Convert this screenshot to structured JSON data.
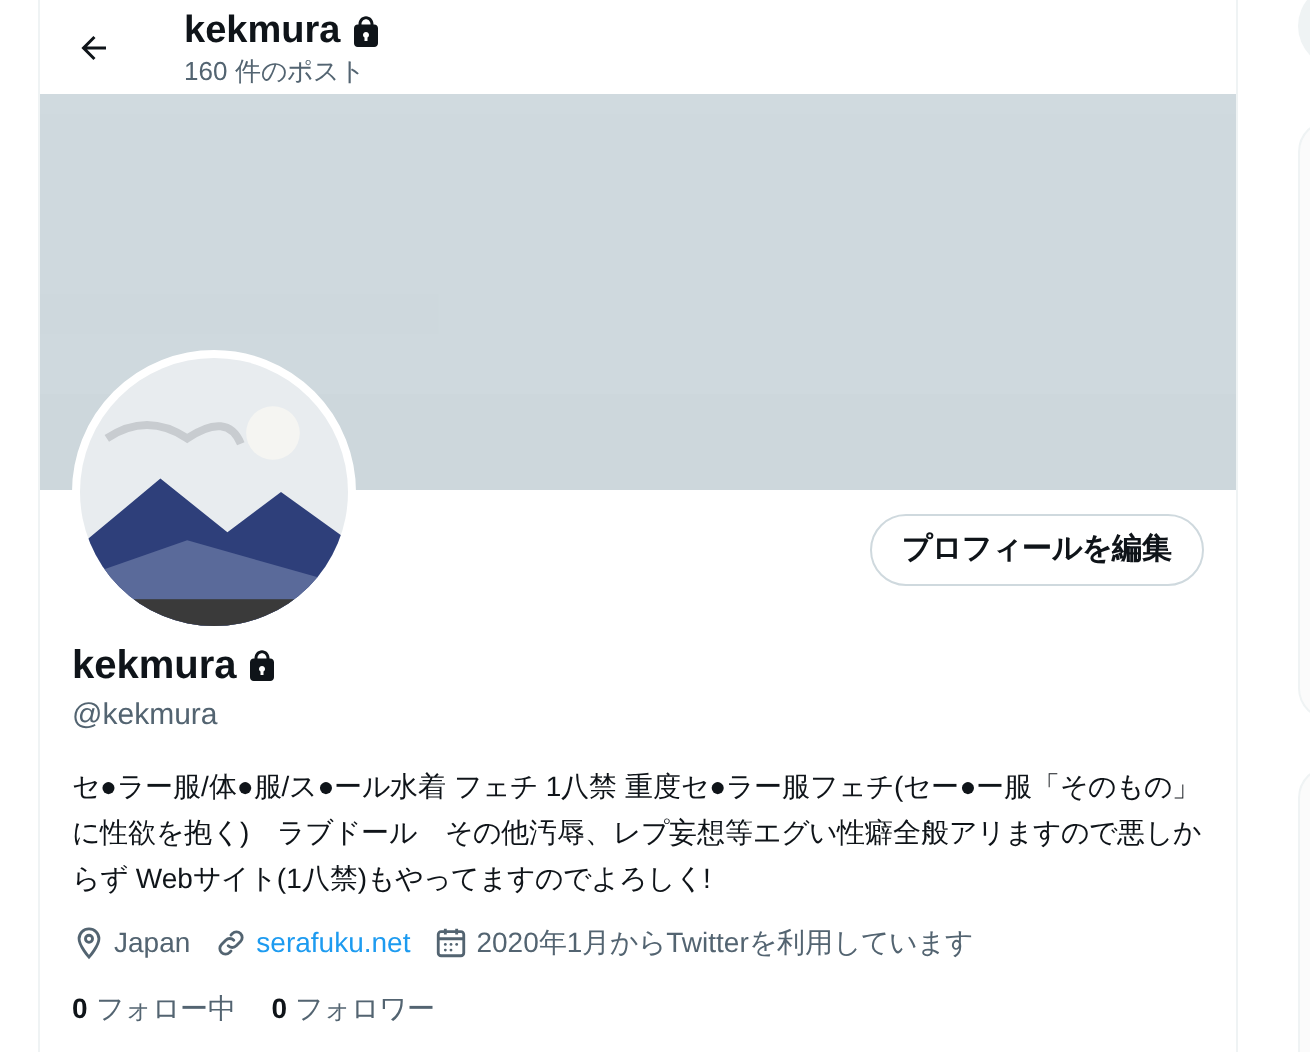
{
  "header": {
    "title": "kekmura",
    "protected": true,
    "post_count": "160 件のポスト"
  },
  "edit_profile_button": "プロフィールを編集",
  "profile": {
    "name": "kekmura",
    "protected": true,
    "handle": "@kekmura",
    "bio": "セ●ラー服/体●服/ス●ール水着 フェチ 1八禁 重度セ●ラー服フェチ(セー●ー服「そのもの」に性欲を抱く)　ラブドール　その他汚辱、レプ妄想等エグい性癖全般アリますので悪しからず Webサイト(1八禁)もやってますのでよろしく!",
    "meta": [
      {
        "kind": "location",
        "text": "Japan"
      },
      {
        "kind": "link",
        "text": "serafuku.net"
      },
      {
        "kind": "joined",
        "text": "2020年1月からTwitterを利用しています"
      }
    ],
    "stats": [
      {
        "count": "0",
        "label": "フォロー中"
      },
      {
        "count": "0",
        "label": "フォロワー"
      }
    ]
  }
}
